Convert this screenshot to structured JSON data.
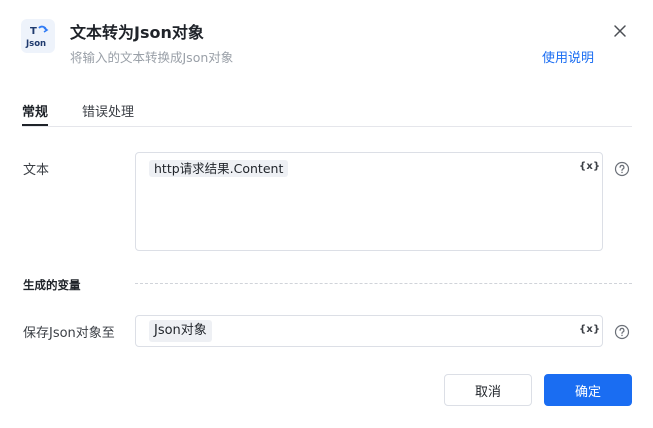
{
  "header": {
    "icon_text_top": "T",
    "icon_text_bottom": "Json",
    "title": "文本转为Json对象",
    "subtitle": "将输入的文本转换成Json对象",
    "help_label": "使用说明"
  },
  "tabs": [
    {
      "label": "常规",
      "active": true
    },
    {
      "label": "错误处理",
      "active": false
    }
  ],
  "form": {
    "text_label": "文本",
    "text_value": "http请求结果.Content",
    "variable_button": "{x}",
    "section_title": "生成的变量",
    "save_label": "保存Json对象至",
    "save_value": "Json对象"
  },
  "footer": {
    "cancel_label": "取消",
    "ok_label": "确定"
  },
  "colors": {
    "accent": "#1a6df2",
    "text": "#1f2329",
    "muted": "#9aa0a8",
    "border": "#dcdfe6",
    "chip_bg": "#eef0f4"
  },
  "icons": {
    "app": "json-convert-icon",
    "close": "close-icon",
    "help": "question-circle-icon"
  }
}
